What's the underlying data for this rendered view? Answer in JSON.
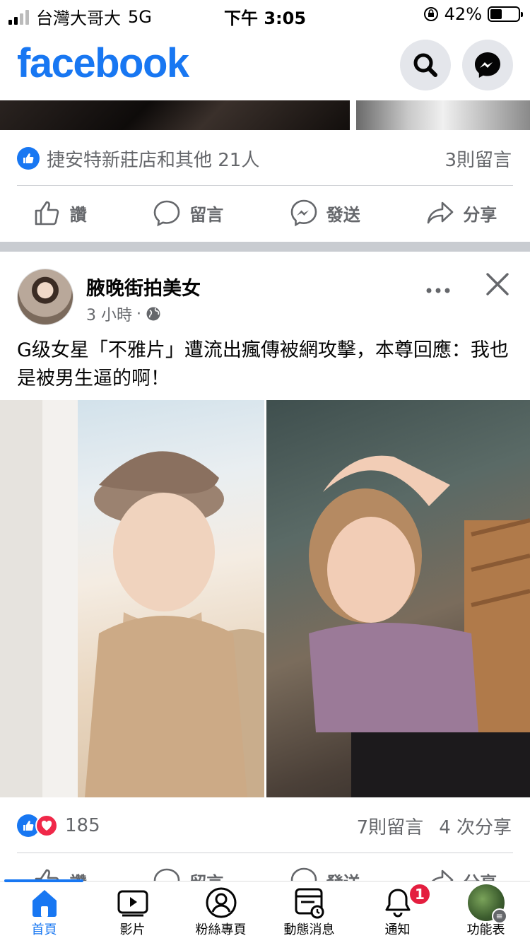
{
  "status_bar": {
    "carrier": "台灣大哥大",
    "network": "5G",
    "time": "下午 3:05",
    "battery": "42%",
    "battery_level": 0.42
  },
  "header": {
    "logo": "facebook",
    "icons": [
      "search-icon",
      "messenger-icon"
    ]
  },
  "prev_post": {
    "reactions_text": "捷安特新莊店和其他 21人",
    "comments": "3則留言"
  },
  "actions": {
    "like": "讚",
    "comment": "留言",
    "send": "發送",
    "share": "分享"
  },
  "post": {
    "author": "腋晚街拍美女",
    "time": "3 小時",
    "privacy_icon": "globe-icon",
    "text": "G级女星「不雅片」遭流出瘋傳被網攻擊，本尊回應：我也是被男生逼的啊！",
    "reaction_count": "185",
    "comments": "7則留言",
    "shares": "4 次分享"
  },
  "colors": {
    "brand": "#1877F2",
    "love": "#f02849",
    "badge": "#e41e3f"
  },
  "tabs": [
    {
      "label": "首頁",
      "icon": "home-icon",
      "active": true
    },
    {
      "label": "影片",
      "icon": "video-icon"
    },
    {
      "label": "粉絲專頁",
      "icon": "pages-icon"
    },
    {
      "label": "動態消息",
      "icon": "feeds-icon"
    },
    {
      "label": "通知",
      "icon": "bell-icon",
      "badge": "1"
    },
    {
      "label": "功能表",
      "icon": "menu-icon"
    }
  ]
}
